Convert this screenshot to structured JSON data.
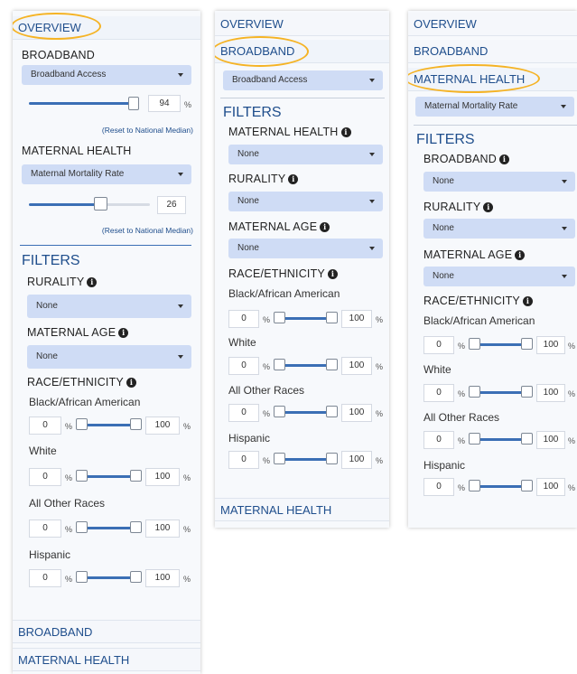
{
  "panel1": {
    "tab_overview": "OVERVIEW",
    "section_broadband": "BROADBAND",
    "broadband_select": "Broadband Access",
    "broadband_value": "94",
    "unit_percent": "%",
    "reset_label": "(Reset to National Median)",
    "section_maternal": "MATERNAL HEALTH",
    "maternal_select": "Maternal Mortality Rate",
    "maternal_value": "26",
    "filters_title": "FILTERS",
    "rurality_label": "RURALITY",
    "rurality_value": "None",
    "maternal_age_label": "MATERNAL AGE",
    "maternal_age_value": "None",
    "race_label": "RACE/ETHNICITY",
    "races": [
      {
        "name": "Black/African American",
        "min": "0",
        "max": "100"
      },
      {
        "name": "White",
        "min": "0",
        "max": "100"
      },
      {
        "name": "All Other Races",
        "min": "0",
        "max": "100"
      },
      {
        "name": "Hispanic",
        "min": "0",
        "max": "100"
      }
    ],
    "tab_broadband": "BROADBAND",
    "tab_maternal": "MATERNAL HEALTH"
  },
  "panel2": {
    "tab_overview": "OVERVIEW",
    "tab_broadband": "BROADBAND",
    "broadband_select": "Broadband Access",
    "filters_title": "FILTERS",
    "maternal_label": "MATERNAL HEALTH",
    "maternal_value": "None",
    "rurality_label": "RURALITY",
    "rurality_value": "None",
    "maternal_age_label": "MATERNAL AGE",
    "maternal_age_value": "None",
    "race_label": "RACE/ETHNICITY",
    "races": [
      {
        "name": "Black/African American",
        "min": "0",
        "max": "100"
      },
      {
        "name": "White",
        "min": "0",
        "max": "100"
      },
      {
        "name": "All Other Races",
        "min": "0",
        "max": "100"
      },
      {
        "name": "Hispanic",
        "min": "0",
        "max": "100"
      }
    ],
    "tab_maternal": "MATERNAL HEALTH"
  },
  "panel3": {
    "tab_overview": "OVERVIEW",
    "tab_broadband": "BROADBAND",
    "tab_maternal": "MATERNAL HEALTH",
    "maternal_select": "Maternal Mortality Rate",
    "filters_title": "FILTERS",
    "broadband_label": "BROADBAND",
    "broadband_value": "None",
    "rurality_label": "RURALITY",
    "rurality_value": "None",
    "maternal_age_label": "MATERNAL AGE",
    "maternal_age_value": "None",
    "race_label": "RACE/ETHNICITY",
    "races": [
      {
        "name": "Black/African American",
        "min": "0",
        "max": "100"
      },
      {
        "name": "White",
        "min": "0",
        "max": "100"
      },
      {
        "name": "All Other Races",
        "min": "0",
        "max": "100"
      },
      {
        "name": "Hispanic",
        "min": "0",
        "max": "100"
      }
    ]
  },
  "levels": {
    "broadband_slider_fraction": 0.94,
    "maternal_slider_fraction": 0.5
  },
  "colors": {
    "highlight_oval": "#f5b324",
    "accent_blue": "#1f4e8c",
    "select_bg": "#cfdcf5",
    "slider_fill": "#3b6fb5"
  }
}
